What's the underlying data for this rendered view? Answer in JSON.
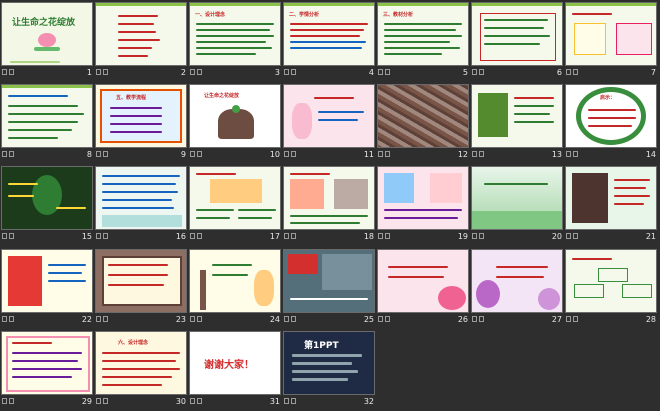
{
  "slides": [
    {
      "number": "1",
      "title": "让生命之花绽放",
      "style": "flowers-cover"
    },
    {
      "number": "2",
      "title": "",
      "style": "green-list"
    },
    {
      "number": "3",
      "title": "一、设计理念",
      "style": "green-text"
    },
    {
      "number": "4",
      "title": "二、学情分析",
      "style": "green-text"
    },
    {
      "number": "5",
      "title": "三、教材分析",
      "style": "green-text"
    },
    {
      "number": "6",
      "title": "",
      "style": "green-text-box"
    },
    {
      "number": "7",
      "title": "",
      "style": "green-notes"
    },
    {
      "number": "8",
      "title": "",
      "style": "green-list"
    },
    {
      "number": "9",
      "title": "五、教学流程",
      "style": "orange-box"
    },
    {
      "number": "10",
      "title": "让生命之花绽放",
      "style": "hands-seedling"
    },
    {
      "number": "11",
      "title": "",
      "style": "pink-girl"
    },
    {
      "number": "12",
      "title": "",
      "style": "photo-ruins"
    },
    {
      "number": "13",
      "title": "",
      "style": "green-photo"
    },
    {
      "number": "14",
      "title": "启示：",
      "style": "wreath"
    },
    {
      "number": "15",
      "title": "",
      "style": "dark-tree"
    },
    {
      "number": "16",
      "title": "",
      "style": "lotus-text"
    },
    {
      "number": "17",
      "title": "",
      "style": "painting"
    },
    {
      "number": "18",
      "title": "",
      "style": "painting"
    },
    {
      "number": "19",
      "title": "",
      "style": "painting-pink"
    },
    {
      "number": "20",
      "title": "",
      "style": "green-field"
    },
    {
      "number": "21",
      "title": "",
      "style": "dance-photo"
    },
    {
      "number": "22",
      "title": "",
      "style": "athletes"
    },
    {
      "number": "23",
      "title": "",
      "style": "brown-frame"
    },
    {
      "number": "24",
      "title": "",
      "style": "signpost"
    },
    {
      "number": "25",
      "title": "",
      "style": "flag-photo"
    },
    {
      "number": "26",
      "title": "",
      "style": "pink-flowers"
    },
    {
      "number": "27",
      "title": "",
      "style": "lotus-flowers"
    },
    {
      "number": "28",
      "title": "",
      "style": "green-cards"
    },
    {
      "number": "29",
      "title": "",
      "style": "pink-frame"
    },
    {
      "number": "30",
      "title": "六、设计理念",
      "style": "cream-text"
    },
    {
      "number": "31",
      "title": "谢谢大家！",
      "style": "thanks"
    },
    {
      "number": "32",
      "title": "第1PPT",
      "style": "ppt-ad"
    }
  ]
}
